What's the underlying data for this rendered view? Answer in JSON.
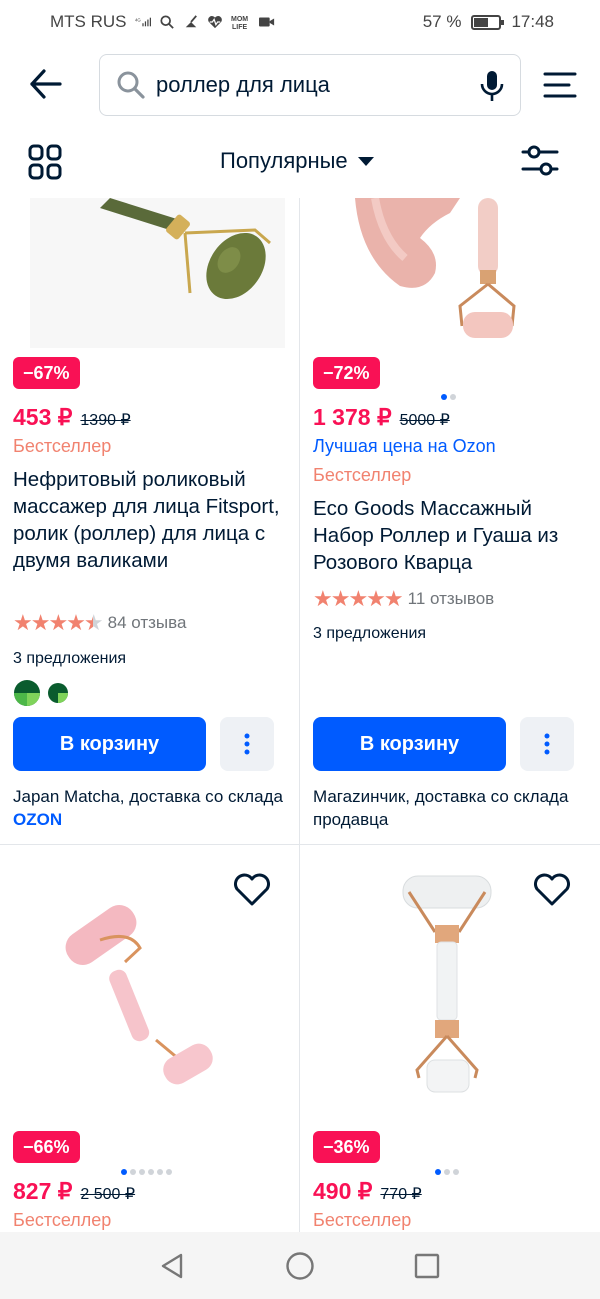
{
  "status": {
    "carrier": "MTS RUS",
    "network": "4G",
    "battery": "57 %",
    "time": "17:48",
    "icons": [
      "signal-icon",
      "search-icon",
      "broom-icon",
      "heart-pulse-icon",
      "mom-life-icon",
      "video-icon"
    ],
    "mom_life": "MOM LIFE"
  },
  "search": {
    "query": "роллер для лица"
  },
  "filter": {
    "sort_label": "Популярные"
  },
  "colors": {
    "accent": "#005bff",
    "sale": "#f91155",
    "bestseller": "#f1826f"
  },
  "products": [
    {
      "badge": "−67%",
      "price": "453 ₽",
      "old_price": "1390 ₽",
      "tag": "Бестселлер",
      "title": "Нефритовый роликовый массажер для лица Fitsport, ролик (роллер) для лица с двумя валиками",
      "rating": 4.5,
      "reviews": "84 отзыва",
      "offers": "3 предложения",
      "button": "В корзину",
      "seller_prefix": "Japan Matcha, доставка со склада",
      "seller_brand": "OZON"
    },
    {
      "badge": "−72%",
      "price": "1 378 ₽",
      "old_price": "5000 ₽",
      "best_price": "Лучшая цена на Ozon",
      "tag": "Бестселлер",
      "title": "Eco Goods Массажный Набор Роллер и Гуаша из Розового Кварца",
      "rating": 5,
      "reviews": "11 отзывов",
      "offers": "3 предложения",
      "button": "В корзину",
      "seller": "Магаzинчик, доставка со склада продавца"
    },
    {
      "badge": "−66%",
      "price": "827 ₽",
      "old_price": "2 500 ₽",
      "tag": "Бестселлер"
    },
    {
      "badge": "−36%",
      "price": "490 ₽",
      "old_price": "770 ₽",
      "tag": "Бестселлер"
    }
  ]
}
